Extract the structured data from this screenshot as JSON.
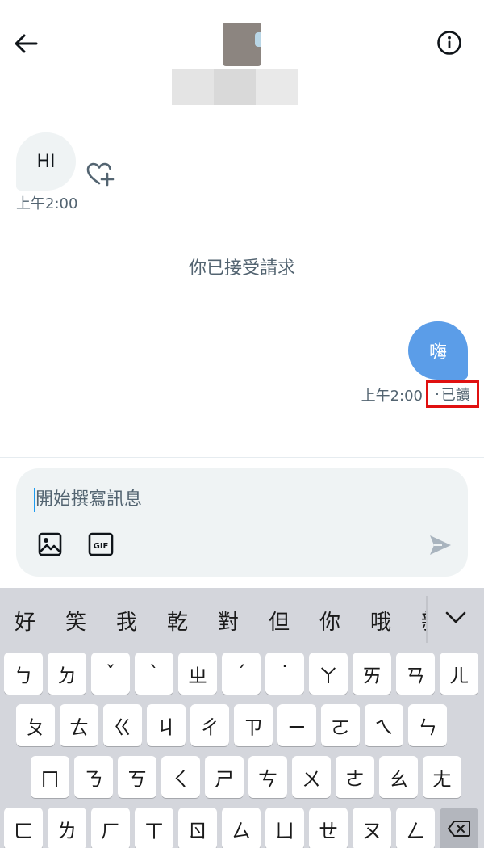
{
  "header": {
    "back_icon": "arrow-left-icon",
    "info_icon": "info-circle-icon"
  },
  "messages": {
    "incoming": {
      "text": "HI",
      "time": "上午2:00"
    },
    "system": "你已接受請求",
    "outgoing": {
      "text": "嗨",
      "time": "上午2:00",
      "status": "已讀"
    }
  },
  "composer": {
    "placeholder": "開始撰寫訊息",
    "image_icon": "image-icon",
    "gif_icon": "gif-icon",
    "send_icon": "send-icon",
    "gif_label": "GIF"
  },
  "keyboard": {
    "suggestions": [
      "好",
      "笑",
      "我",
      "乾",
      "對",
      "但",
      "你",
      "哦",
      "親"
    ],
    "row1": [
      "ㄅ",
      "ㄉ",
      "ˇ",
      "ˋ",
      "ㄓ",
      "ˊ",
      "˙",
      "ㄚ",
      "ㄞ",
      "ㄢ",
      "ㄦ"
    ],
    "row2": [
      "ㄆ",
      "ㄊ",
      "ㄍ",
      "ㄐ",
      "ㄔ",
      "ㄗ",
      "ㄧ",
      "ㄛ",
      "ㄟ",
      "ㄣ"
    ],
    "row3": [
      "ㄇ",
      "ㄋ",
      "ㄎ",
      "ㄑ",
      "ㄕ",
      "ㄘ",
      "ㄨ",
      "ㄜ",
      "ㄠ",
      "ㄤ"
    ],
    "row4": [
      "ㄈ",
      "ㄌ",
      "ㄏ",
      "ㄒ",
      "ㄖ",
      "ㄙ",
      "ㄩ",
      "ㄝ",
      "ㄡ",
      "ㄥ"
    ],
    "delete_icon": "backspace-icon",
    "collapse_icon": "chevron-down-icon"
  },
  "colors": {
    "outgoing_bubble": "#5b9de8",
    "incoming_bubble": "#eff3f4",
    "highlight_box": "#e01010"
  }
}
